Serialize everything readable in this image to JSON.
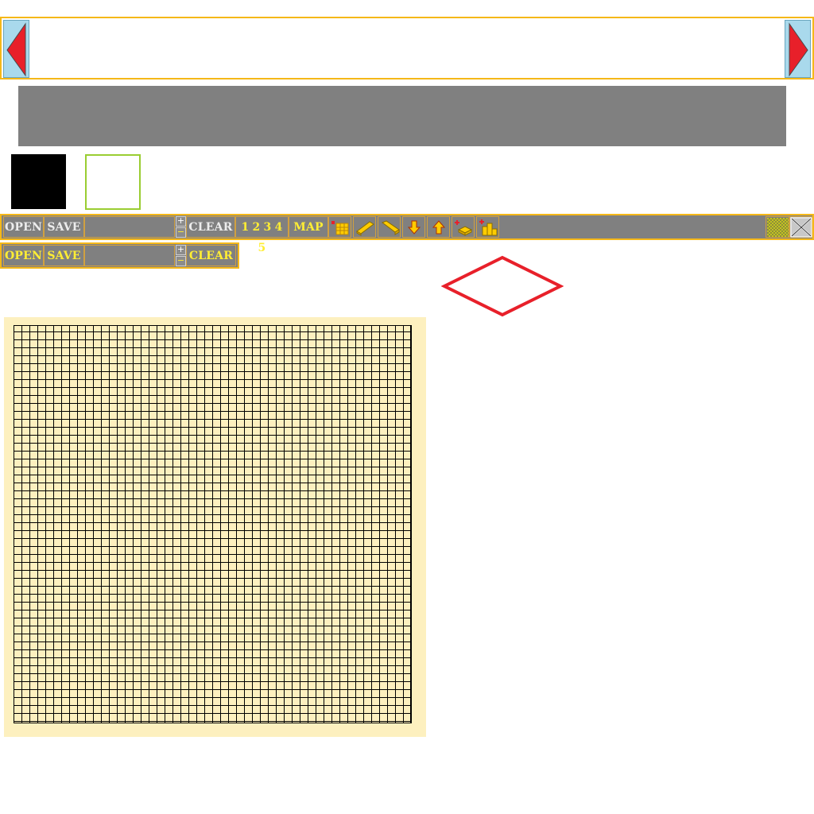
{
  "palette_strip": {
    "left_arrow_icon": "arrow-left-icon",
    "right_arrow_icon": "arrow-right-icon"
  },
  "colors": {
    "accent_border": "#f5b818",
    "toolbar_bg": "#808080",
    "yellow_text": "#ffee33",
    "arrow_red": "#e8202a",
    "arrow_bg": "#a9d9ec",
    "map_bg": "#fdf0bf",
    "selected_tile": "#000000",
    "secondary_tile_border": "#9acd32",
    "diamond_outline": "#e8202a"
  },
  "toolbar_main": {
    "open_label": "OPEN",
    "save_label": "SAVE",
    "filename_value": "",
    "plus_label": "+",
    "minus_label": "−",
    "clear_label": "CLEAR",
    "layers": [
      "1",
      "2",
      "3",
      "4",
      "5"
    ],
    "map_label": "MAP",
    "tools": [
      "grid-icon",
      "wall-horizontal-icon",
      "wall-diagonal-icon",
      "move-down-icon",
      "move-up-icon",
      "add-block-icon",
      "add-stack-icon"
    ],
    "pattern_icon": "pattern-icon",
    "close_icon": "close-icon"
  },
  "toolbar_second": {
    "open_label": "OPEN",
    "save_label": "SAVE",
    "filename_value": "",
    "plus_label": "+",
    "minus_label": "−",
    "clear_label": "CLEAR"
  },
  "map": {
    "columns": 50,
    "rows": 50
  }
}
